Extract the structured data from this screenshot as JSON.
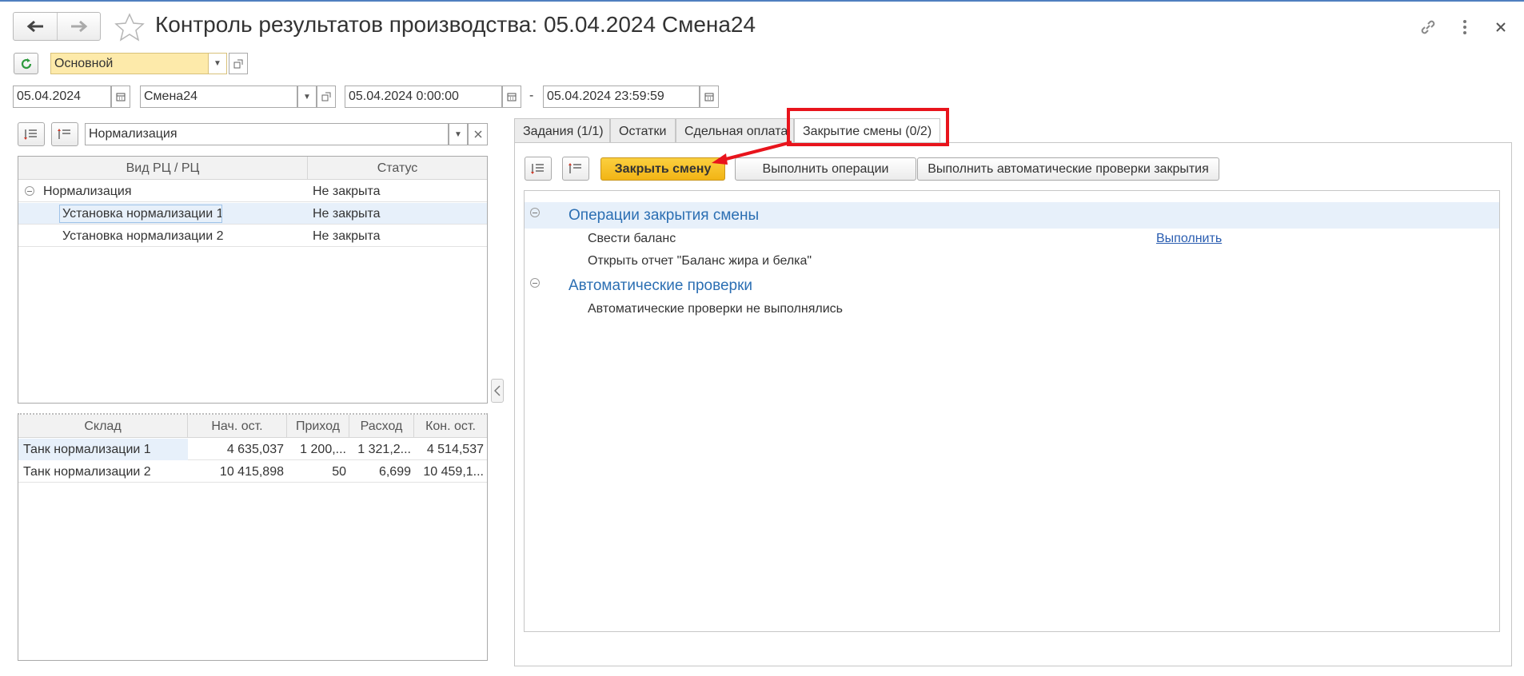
{
  "header": {
    "title": "Контроль результатов производства: 05.04.2024 Смена24"
  },
  "toolbar": {
    "variant": "Основной"
  },
  "filters": {
    "date": "05.04.2024",
    "shift": "Смена24",
    "start": "05.04.2024  0:00:00",
    "separator": "-",
    "end": "05.04.2024 23:59:59"
  },
  "left": {
    "filter_value": "Нормализация",
    "tree": {
      "columns": [
        "Вид РЦ / РЦ",
        "Статус"
      ],
      "rows": [
        {
          "name": "Нормализация",
          "status": "Не закрыта"
        },
        {
          "name": "Установка нормализации 1",
          "status": "Не закрыта"
        },
        {
          "name": "Установка нормализации 2",
          "status": "Не закрыта"
        }
      ]
    },
    "stock": {
      "columns": [
        "Склад",
        "Нач. ост.",
        "Приход",
        "Расход",
        "Кон. ост."
      ],
      "rows": [
        [
          "Танк нормализации 1",
          "4 635,037",
          "1 200,...",
          "1 321,2...",
          "4 514,537"
        ],
        [
          "Танк нормализации 2",
          "10 415,898",
          "50",
          "6,699",
          "10 459,1..."
        ]
      ]
    }
  },
  "tabs": [
    {
      "label": "Задания (1/1)"
    },
    {
      "label": "Остатки"
    },
    {
      "label": "Сдельная оплата"
    },
    {
      "label": "Закрытие смены (0/2)"
    }
  ],
  "shift_close": {
    "close_button": "Закрыть смену",
    "run_ops_button": "Выполнить операции",
    "auto_check_button": "Выполнить автоматические проверки закрытия",
    "ops_section": "Операции закрытия смены",
    "ops": [
      {
        "name": "Свести баланс",
        "action": "Выполнить"
      },
      {
        "name": "Открыть отчет \"Баланс жира и белка\""
      }
    ],
    "checks_section": "Автоматические проверки",
    "checks_text": "Автоматические проверки не выполнялись"
  },
  "colors": {
    "accent_yellow": "#f5bd1f",
    "selected_row": "#e7f0fa",
    "highlight_red": "#e8141c",
    "section_blue": "#2c6fb3",
    "variant_field": "#fdeaaa"
  },
  "icons": [
    "arrow-left-icon",
    "arrow-right-icon",
    "star-icon",
    "link-icon",
    "more-icon",
    "close-icon",
    "refresh-icon",
    "calendar-icon",
    "expand-all-icon",
    "collapse-all-icon"
  ]
}
